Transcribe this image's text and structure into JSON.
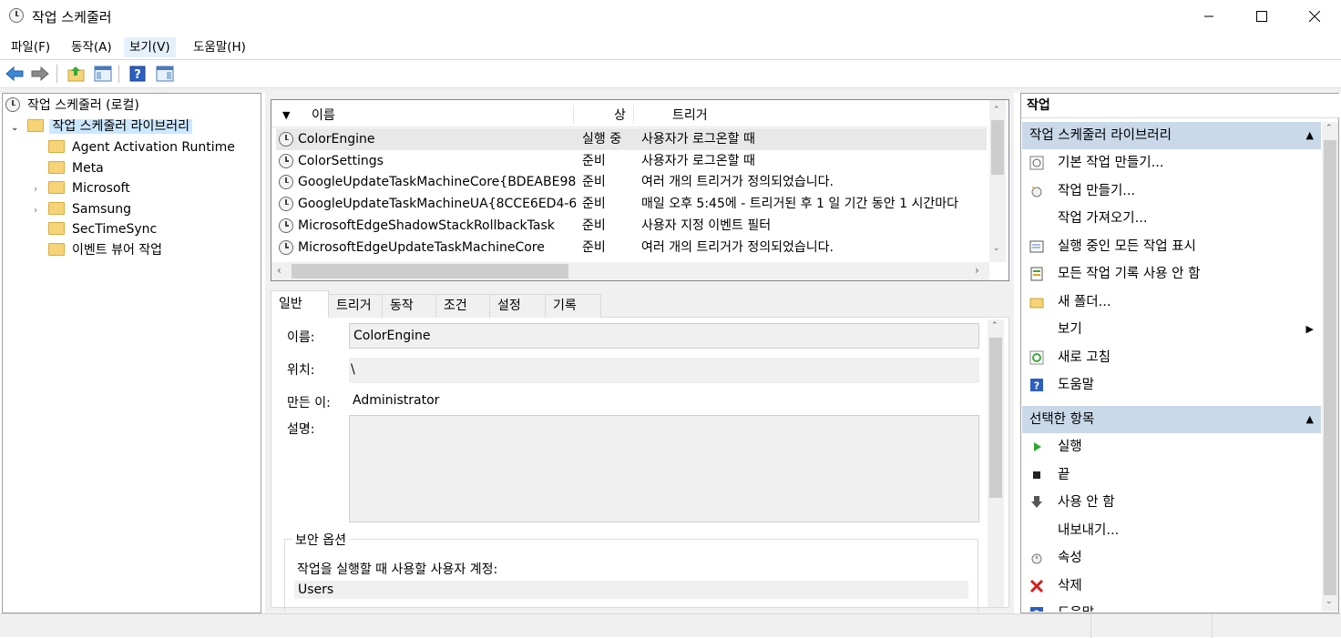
{
  "window": {
    "title": "작업 스케줄러"
  },
  "menu": [
    "파일(F)",
    "동작(A)",
    "보기(V)",
    "도움말(H)"
  ],
  "tree": {
    "root": "작업 스케줄러 (로컬)",
    "library": "작업 스케줄러 라이브러리",
    "folders": [
      {
        "label": "Agent Activation Runtime",
        "expandable": false
      },
      {
        "label": "Meta",
        "expandable": false
      },
      {
        "label": "Microsoft",
        "expandable": true
      },
      {
        "label": "Samsung",
        "expandable": true
      },
      {
        "label": "SecTimeSync",
        "expandable": false
      },
      {
        "label": "이벤트 뷰어 작업",
        "expandable": false
      }
    ]
  },
  "tasklist": {
    "columns": [
      "이름",
      "상",
      "트리거"
    ],
    "rows": [
      {
        "name": "ColorEngine",
        "status": "실행 중",
        "trigger": "사용자가 로그온할 때"
      },
      {
        "name": "ColorSettings",
        "status": "준비",
        "trigger": "사용자가 로그온할 때"
      },
      {
        "name": "GoogleUpdateTaskMachineCore{BDEABE98-...",
        "status": "준비",
        "trigger": "여러 개의 트리거가 정의되었습니다."
      },
      {
        "name": "GoogleUpdateTaskMachineUA{8CCE6ED4-68...",
        "status": "준비",
        "trigger": "매일 오후 5:45에 - 트리거된 후 1 일 기간 동안 1 시간마다"
      },
      {
        "name": "MicrosoftEdgeShadowStackRollbackTask",
        "status": "준비",
        "trigger": "사용자 지정 이벤트 필터"
      },
      {
        "name": "MicrosoftEdgeUpdateTaskMachineCore",
        "status": "준비",
        "trigger": "여러 개의 트리거가 정의되었습니다."
      }
    ]
  },
  "detail": {
    "tabs": [
      "일반",
      "트리거",
      "동작",
      "조건",
      "설정",
      "기록"
    ],
    "name_label": "이름:",
    "name_value": "ColorEngine",
    "location_label": "위치:",
    "location_value": "\\",
    "author_label": "만든 이:",
    "author_value": "Administrator",
    "desc_label": "설명:",
    "security_legend": "보안 옵션",
    "security_text": "작업을 실행할 때 사용할 사용자 계정:",
    "security_user": "Users"
  },
  "actions": {
    "title": "작업",
    "section1": "작업 스케줄러 라이브러리",
    "items1": [
      {
        "label": "기본 작업 만들기...",
        "icon": "basic-task-icon"
      },
      {
        "label": "작업 만들기...",
        "icon": "create-task-icon"
      },
      {
        "label": "작업 가져오기...",
        "icon": ""
      },
      {
        "label": "실행 중인 모든 작업 표시",
        "icon": "running-tasks-icon"
      },
      {
        "label": "모든 작업 기록 사용 안 함",
        "icon": "history-icon"
      },
      {
        "label": "새 폴더...",
        "icon": "folder-icon"
      },
      {
        "label": "보기",
        "icon": ""
      },
      {
        "label": "새로 고침",
        "icon": "refresh-icon"
      },
      {
        "label": "도움말",
        "icon": "help-icon"
      }
    ],
    "section2": "선택한 항목",
    "items2": [
      {
        "label": "실행",
        "icon": "run-icon"
      },
      {
        "label": "끝",
        "icon": "stop-icon"
      },
      {
        "label": "사용 안 함",
        "icon": "disable-icon"
      },
      {
        "label": "내보내기...",
        "icon": ""
      },
      {
        "label": "속성",
        "icon": "properties-icon"
      },
      {
        "label": "삭제",
        "icon": "delete-icon"
      },
      {
        "label": "도움말",
        "icon": "help-icon"
      }
    ]
  }
}
